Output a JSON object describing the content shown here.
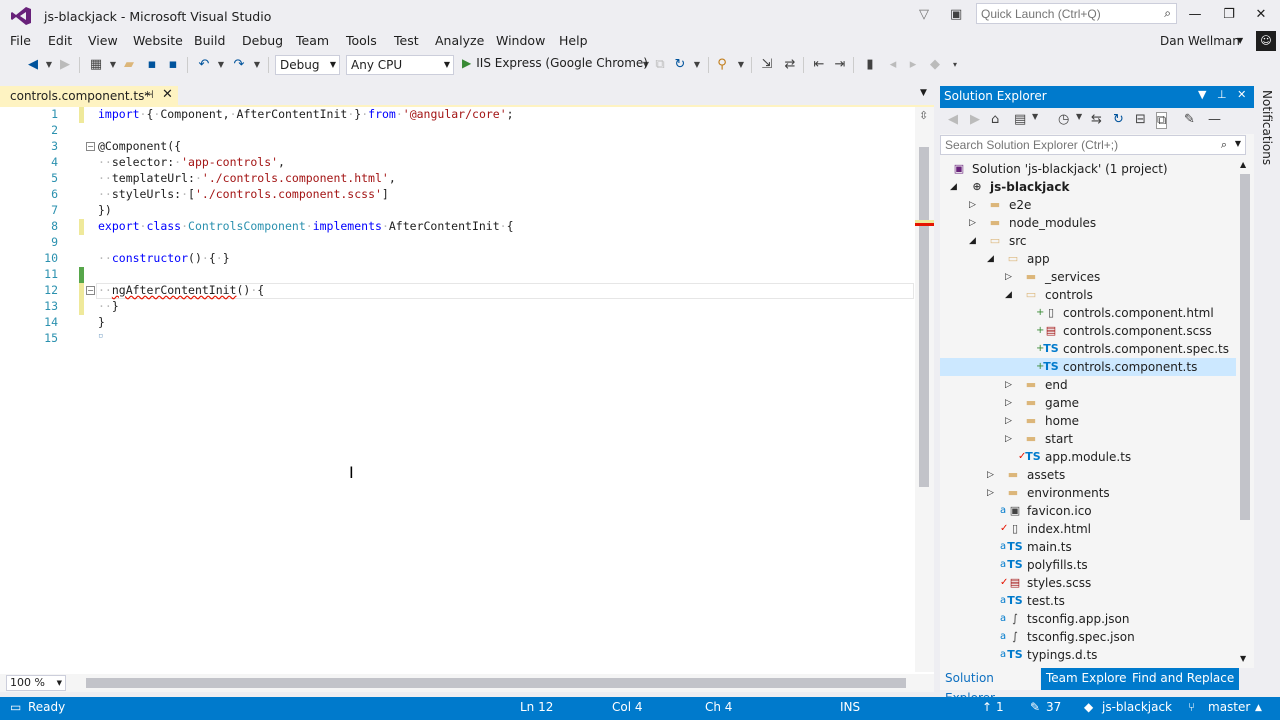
{
  "window": {
    "title": "js-blackjack - Microsoft Visual Studio",
    "quick_launch_placeholder": "Quick Launch (Ctrl+Q)",
    "controls": [
      "minimize-icon",
      "maximize-icon",
      "close-icon"
    ]
  },
  "menu": [
    "File",
    "Edit",
    "View",
    "Website",
    "Build",
    "Debug",
    "Team",
    "Tools",
    "Test",
    "Analyze",
    "Window",
    "Help"
  ],
  "user": {
    "name": "Dan Wellman"
  },
  "toolbar": {
    "config": "Debug",
    "platform": "Any CPU",
    "run_target": "IIS Express (Google Chrome)"
  },
  "editor": {
    "tab_label": "controls.component.ts*",
    "zoom": "100 %",
    "line_numbers": [
      "1",
      "2",
      "3",
      "4",
      "5",
      "6",
      "7",
      "8",
      "9",
      "10",
      "11",
      "12",
      "13",
      "14",
      "15"
    ]
  },
  "solution_explorer": {
    "title": "Solution Explorer",
    "search_placeholder": "Search Solution Explorer (Ctrl+;)",
    "items": [
      {
        "label": "Solution 'js-blackjack' (1 project)",
        "icon": "solution-icon"
      },
      {
        "label": "js-blackjack",
        "icon": "web-project-icon"
      },
      {
        "label": "e2e",
        "icon": "folder-icon"
      },
      {
        "label": "node_modules",
        "icon": "folder-icon"
      },
      {
        "label": "src",
        "icon": "folder-open-icon"
      },
      {
        "label": "app",
        "icon": "folder-open-icon"
      },
      {
        "label": "_services",
        "icon": "folder-icon"
      },
      {
        "label": "controls",
        "icon": "folder-open-icon"
      },
      {
        "label": "controls.component.html",
        "icon": "html-file-icon"
      },
      {
        "label": "controls.component.scss",
        "icon": "scss-file-icon"
      },
      {
        "label": "controls.component.spec.ts",
        "icon": "ts-file-icon"
      },
      {
        "label": "controls.component.ts",
        "icon": "ts-file-icon"
      },
      {
        "label": "end",
        "icon": "folder-icon"
      },
      {
        "label": "game",
        "icon": "folder-icon"
      },
      {
        "label": "home",
        "icon": "folder-icon"
      },
      {
        "label": "start",
        "icon": "folder-icon"
      },
      {
        "label": "app.module.ts",
        "icon": "ts-file-icon"
      },
      {
        "label": "assets",
        "icon": "folder-icon"
      },
      {
        "label": "environments",
        "icon": "folder-icon"
      },
      {
        "label": "favicon.ico",
        "icon": "image-file-icon"
      },
      {
        "label": "index.html",
        "icon": "html-file-icon"
      },
      {
        "label": "main.ts",
        "icon": "ts-file-icon"
      },
      {
        "label": "polyfills.ts",
        "icon": "ts-file-icon"
      },
      {
        "label": "styles.scss",
        "icon": "scss-file-icon"
      },
      {
        "label": "test.ts",
        "icon": "ts-file-icon"
      },
      {
        "label": "tsconfig.app.json",
        "icon": "json-file-icon"
      },
      {
        "label": "tsconfig.spec.json",
        "icon": "json-file-icon"
      },
      {
        "label": "typings.d.ts",
        "icon": "ts-file-icon"
      }
    ],
    "tabs": [
      "Solution Explorer",
      "Team Explorer",
      "Find and Replace"
    ]
  },
  "notifications_label": "Notifications",
  "status": {
    "ready": "Ready",
    "line": "Ln 12",
    "col": "Col 4",
    "ch": "Ch 4",
    "mode": "INS",
    "pushes": "1",
    "changes": "37",
    "repo": "js-blackjack",
    "branch": "master"
  },
  "colors": {
    "accent": "#007acc",
    "tab_active": "#fef3c2",
    "keyword": "#0000ff",
    "type": "#2b91af",
    "string": "#a31515"
  }
}
